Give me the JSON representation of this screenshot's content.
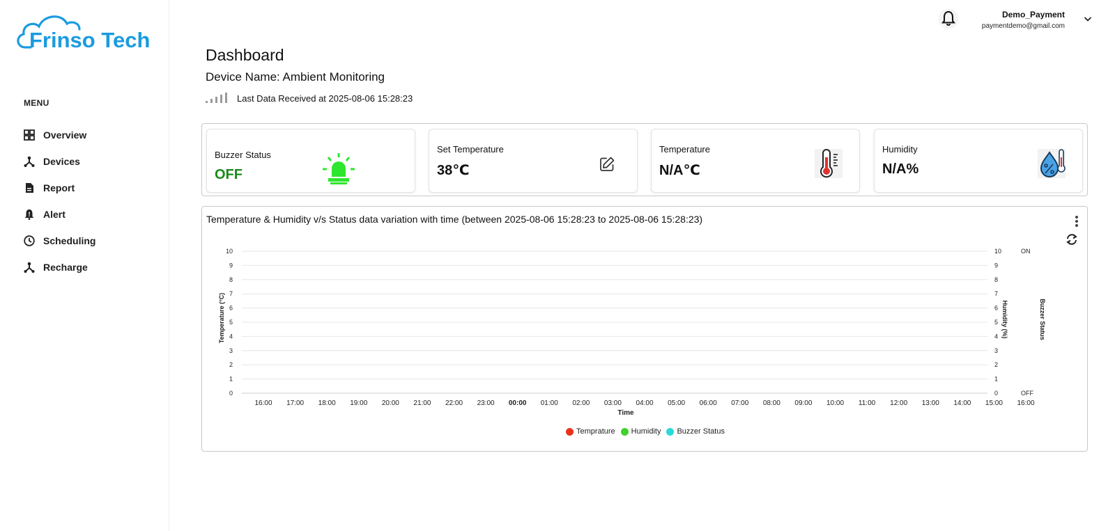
{
  "brand": {
    "name": "Frinso Tech",
    "color": "#1a9be0"
  },
  "sidebar": {
    "menu_heading": "MENU",
    "items": [
      {
        "label": "Overview",
        "icon": "grid-icon"
      },
      {
        "label": "Devices",
        "icon": "devices-icon"
      },
      {
        "label": "Report",
        "icon": "document-icon"
      },
      {
        "label": "Alert",
        "icon": "alert-bell-icon"
      },
      {
        "label": "Scheduling",
        "icon": "clock-icon"
      },
      {
        "label": "Recharge",
        "icon": "recharge-icon"
      }
    ]
  },
  "user": {
    "name": "Demo_Payment",
    "email": "paymentdemo@gmail.com"
  },
  "page": {
    "title": "Dashboard",
    "device_name": "Device Name: Ambient Monitoring",
    "last_data": "Last Data Received at 2025-08-06 15:28:23"
  },
  "cards": {
    "buzzer": {
      "label": "Buzzer Status",
      "value": "OFF",
      "value_color": "#1a8a1a",
      "icon": "siren-icon",
      "icon_color": "#2ee62e"
    },
    "set_temp": {
      "label": "Set Temperature",
      "value": "38℃",
      "icon": "edit-icon"
    },
    "temperature": {
      "label": "Temperature",
      "value": "N/A℃",
      "icon": "thermometer-icon"
    },
    "humidity": {
      "label": "Humidity",
      "value": "N/A%",
      "icon": "humidity-drop-icon"
    }
  },
  "chart_data": {
    "type": "line",
    "title": "Temperature & Humidity v/s Status data variation with time (between 2025-08-06 15:28:23 to 2025-08-06 15:28:23)",
    "xlabel": "Time",
    "ylabel_left": "Temperature (°C)",
    "ylabel_right": "Humidity (%)",
    "ylabel_status": "Buzzer Status",
    "x_ticks": [
      "16:00",
      "17:00",
      "18:00",
      "19:00",
      "20:00",
      "21:00",
      "22:00",
      "23:00",
      "00:00",
      "01:00",
      "02:00",
      "03:00",
      "04:00",
      "05:00",
      "06:00",
      "07:00",
      "08:00",
      "09:00",
      "10:00",
      "11:00",
      "12:00",
      "13:00",
      "14:00",
      "15:00",
      "16:00"
    ],
    "bold_tick": "00:00",
    "y_ticks": [
      "0",
      "1",
      "2",
      "3",
      "4",
      "5",
      "6",
      "7",
      "8",
      "9",
      "10"
    ],
    "ylim": [
      0,
      10
    ],
    "status_ticks": {
      "top": "ON",
      "bottom": "OFF"
    },
    "grid": true,
    "legend_position": "bottom",
    "series": [
      {
        "name": "Temprature",
        "color": "#e8331c",
        "values": []
      },
      {
        "name": "Humidity",
        "color": "#3fd12c",
        "values": []
      },
      {
        "name": "Buzzer Status",
        "color": "#2ad8d8",
        "values": []
      }
    ]
  }
}
